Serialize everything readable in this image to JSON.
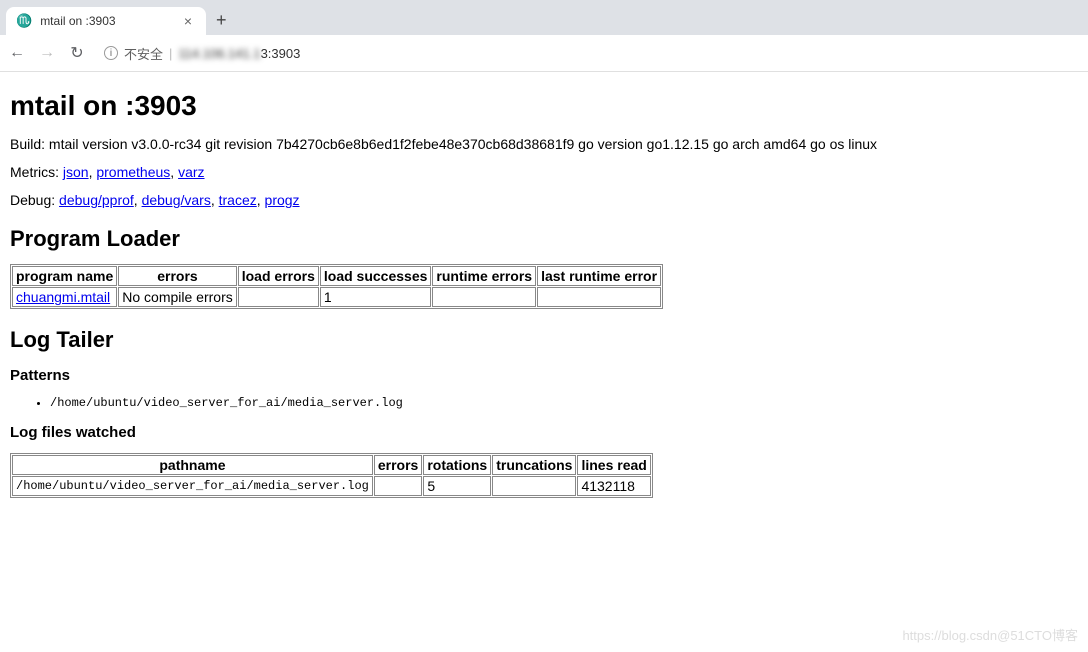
{
  "browser": {
    "tab_title": "mtail on :3903",
    "favicon_glyph": "♏",
    "new_tab_glyph": "+",
    "close_glyph": "×",
    "nav_back": "←",
    "nav_fwd": "→",
    "nav_reload": "↻",
    "info_glyph": "i",
    "insecure_label": "不安全",
    "url_blur": "114.106.141.1",
    "url_tail": "3:3903"
  },
  "page": {
    "h1": "mtail on :3903",
    "build": "Build: mtail version v3.0.0-rc34 git revision 7b4270cb6e8b6ed1f2febe48e370cb68d38681f9 go version go1.12.15 go arch amd64 go os linux",
    "metrics_label": "Metrics: ",
    "metrics_links": {
      "json": "json",
      "prometheus": "prometheus",
      "varz": "varz"
    },
    "debug_label": "Debug: ",
    "debug_links": {
      "pprof": "debug/pprof",
      "vars": "debug/vars",
      "tracez": "tracez",
      "progz": "progz"
    }
  },
  "program_loader": {
    "heading": "Program Loader",
    "headers": {
      "program_name": "program name",
      "errors": "errors",
      "load_errors": "load errors",
      "load_successes": "load successes",
      "runtime_errors": "runtime errors",
      "last_runtime_error": "last runtime error"
    },
    "rows": [
      {
        "program_name": "chuangmi.mtail",
        "errors": "No compile errors",
        "load_errors": "",
        "load_successes": "1",
        "runtime_errors": "",
        "last_runtime_error": ""
      }
    ]
  },
  "log_tailer": {
    "heading": "Log Tailer",
    "patterns_heading": "Patterns",
    "patterns": [
      "/home/ubuntu/video_server_for_ai/media_server.log"
    ],
    "watched_heading": "Log files watched",
    "headers": {
      "pathname": "pathname",
      "errors": "errors",
      "rotations": "rotations",
      "truncations": "truncations",
      "lines_read": "lines read"
    },
    "rows": [
      {
        "pathname": "/home/ubuntu/video_server_for_ai/media_server.log",
        "errors": "",
        "rotations": "5",
        "truncations": "",
        "lines_read": "4132118"
      }
    ]
  },
  "watermark": "https://blog.csdn@51CTO博客"
}
